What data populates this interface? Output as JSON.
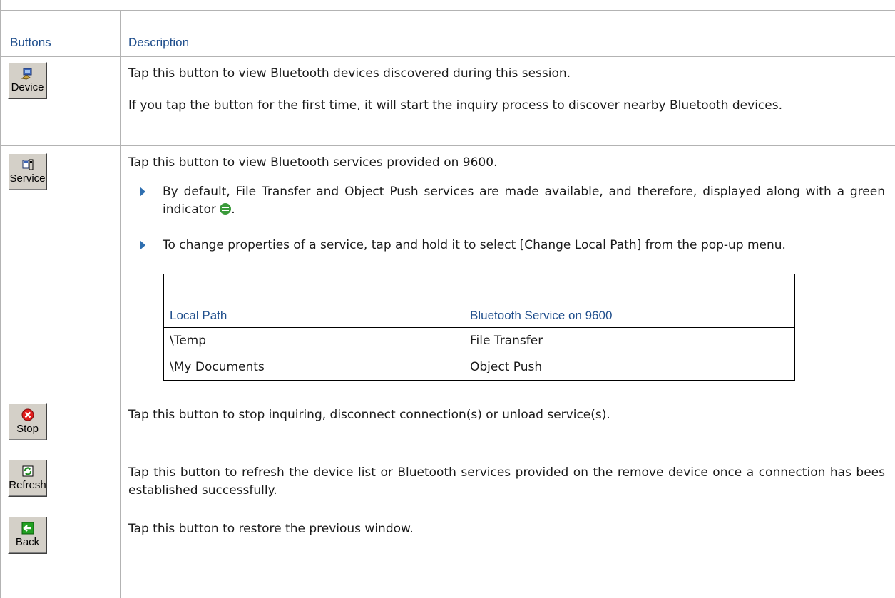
{
  "table": {
    "header": {
      "buttons": "Buttons",
      "description": "Description"
    },
    "rows": [
      {
        "button": {
          "icon": "device-icon",
          "label": "Device"
        },
        "paragraphs": [
          "Tap this button to view Bluetooth devices discovered during this session.",
          "If you tap the button for the first time, it will start the inquiry process to discover nearby Bluetooth devices."
        ]
      },
      {
        "button": {
          "icon": "service-icon",
          "label": "Service"
        },
        "intro": "Tap this button to view Bluetooth services provided on 9600.",
        "bullets": [
          {
            "text": "By default, File Transfer and Object Push services are made available, and therefore, displayed along with a green indicator",
            "icon": "green-indicator-icon"
          },
          {
            "text": "To change properties of a service, tap and hold it to select [Change Local Path] from the pop-up menu."
          }
        ],
        "subtable": {
          "headers": [
            "Local Path",
            "Bluetooth Service on 9600"
          ],
          "rows": [
            [
              "\\Temp",
              "File Transfer"
            ],
            [
              "\\My Documents",
              "Object Push"
            ]
          ]
        }
      },
      {
        "button": {
          "icon": "stop-icon",
          "label": "Stop"
        },
        "paragraphs": [
          "Tap this button to stop inquiring, disconnect connection(s) or unload service(s)."
        ]
      },
      {
        "button": {
          "icon": "refresh-icon",
          "label": "Refresh"
        },
        "paragraphs": [
          "Tap this button to refresh the device list or Bluetooth services provided on the remove device once a connection has bees established successfully."
        ]
      },
      {
        "button": {
          "icon": "back-icon",
          "label": "Back"
        },
        "paragraphs": [
          "Tap this button to restore the previous window."
        ]
      }
    ]
  }
}
